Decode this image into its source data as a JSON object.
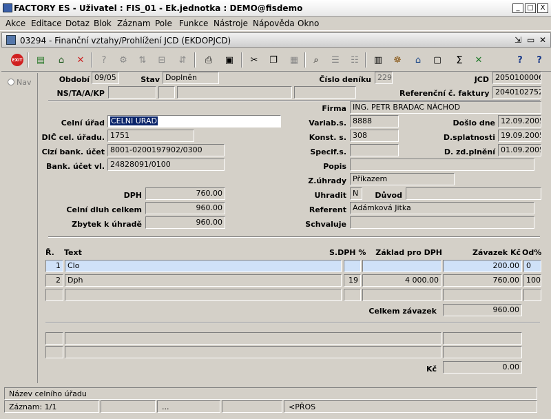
{
  "title_bar": {
    "text": "FACTORY ES - Uživatel : FIS_01 - Ek.jednotka : DEMO@fisdemo",
    "minimize": "_",
    "maximize": "□",
    "close": "X"
  },
  "menu": [
    "Akce",
    "Editace",
    "Dotaz",
    "Blok",
    "Záznam",
    "Pole",
    "Funkce",
    "Nástroje",
    "Nápověda",
    "Okno"
  ],
  "window": {
    "title": "03294 - Finanční vztahy/Prohlížení JCD (EKDOPJCD)",
    "controls": [
      "⇲",
      "▭",
      "✕"
    ]
  },
  "toolbar": {
    "exit_label": "EXIT",
    "sigma": "Σ",
    "help": "?",
    "help2": "?"
  },
  "nav": {
    "label": "Nav"
  },
  "header": {
    "obdobi_label": "Období",
    "obdobi": "09/05",
    "stav_label": "Stav",
    "stav": "Doplněn",
    "cislo_deniku_label": "Číslo deníku",
    "cislo_deniku": "229",
    "jcd_label": "JCD",
    "jcd": "2050100006",
    "ns_label": "NS/TA/A/KP",
    "ref_faktury_label": "Referenční č. faktury",
    "ref_faktury": "2040102752",
    "firma_label": "Firma",
    "firma": "ING. PETR BRADAC NÁCHOD"
  },
  "left": {
    "celni_urad_label": "Celní úřad",
    "celni_urad": "CELNI URAD",
    "dic_label": "DIČ cel. úřadu.",
    "dic": "1751",
    "cizi_ucet_label": "Cizí bank. účet",
    "cizi_ucet": "8001-0200197902/0300",
    "bank_ucet_label": "Bank. účet vl.",
    "bank_ucet": "24828091/0100",
    "dph_label": "DPH",
    "dph": "760.00",
    "celni_dluh_label": "Celní dluh celkem",
    "celni_dluh": "960.00",
    "zbytek_label": "Zbytek k úhradě",
    "zbytek": "960.00"
  },
  "right": {
    "varias_label": "Variab.s.",
    "varias": "8888",
    "konst_label": "Konst. s.",
    "konst": "308",
    "specif_label": "Specif.s.",
    "specif": "",
    "doslo_label": "Došlo dne",
    "doslo": "12.09.2005",
    "splatnost_label": "D.splatnosti",
    "splatnost": "19.09.2005",
    "zdplneni_label": "D. zd.plnění",
    "zdplneni": "01.09.2005",
    "popis_label": "Popis",
    "popis": "",
    "zuhrady_label": "Z.úhrady",
    "zuhrady": "Příkazem",
    "uhradit_label": "Uhradit",
    "uhradit": "N",
    "duvod_label": "Důvod",
    "duvod": "",
    "referent_label": "Referent",
    "referent": "Adámková Jitka",
    "schvaluje_label": "Schvaluje",
    "schvaluje": ""
  },
  "table": {
    "headers": {
      "r": "Ř.",
      "text": "Text",
      "sdph": "S.DPH %",
      "zaklad": "Základ pro DPH",
      "zavazek": "Závazek Kč",
      "od": "Od%"
    },
    "rows": [
      {
        "r": "1",
        "text": "Clo",
        "sdph": "",
        "zaklad": "",
        "zavazek": "200.00",
        "od": "0"
      },
      {
        "r": "2",
        "text": "Dph",
        "sdph": "19",
        "zaklad": "4 000.00",
        "zavazek": "760.00",
        "od": "100"
      },
      {
        "r": "",
        "text": "",
        "sdph": "",
        "zaklad": "",
        "zavazek": "",
        "od": ""
      }
    ],
    "total_label": "Celkem závazek",
    "total": "960.00"
  },
  "lower": {
    "kc_label": "Kč",
    "kc": "0.00"
  },
  "status": {
    "hint": "Název celního úřadu",
    "record": "Záznam: 1/1",
    "dots": "...",
    "mode": "<PŘOS"
  },
  "colors": {
    "selection": "#0a246a",
    "current_row": "#cfe1f8",
    "exit_red": "#d02020"
  }
}
